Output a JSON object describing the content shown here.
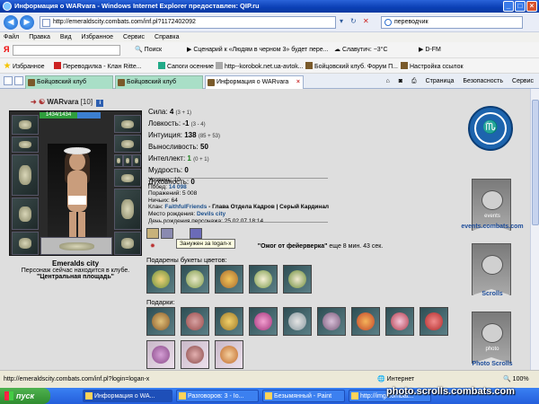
{
  "window": {
    "title": "Информация о WARvara - Windows Internet Explorer предоставлен: QIP.ru"
  },
  "address": {
    "url": "http://emeraldscity.combats.com/inf.pl?1172402092",
    "search_value": "переводчик"
  },
  "menu": [
    "Файл",
    "Правка",
    "Вид",
    "Избранное",
    "Сервис",
    "Справка"
  ],
  "toolbar": {
    "search_btn": "Поиск",
    "script": "Сценарий к «Людям в черном 3» будет пере...",
    "weather": "Славутич: −3°С",
    "dfm": "D-FM"
  },
  "favorites": {
    "label": "Избранное",
    "items": [
      "Переводилка - Клан Ritte...",
      "Сапоги осенние",
      "http--korobok.net.ua-avtok...",
      "Бойцовский клуб. Форум П...",
      "Настройка ссылок"
    ]
  },
  "tabs": [
    {
      "label": "Бойцовский клуб"
    },
    {
      "label": "Бойцовский клуб"
    },
    {
      "label": "Информация о WARvara"
    }
  ],
  "tab_tools": [
    "Страница",
    "Безопасность",
    "Сервис"
  ],
  "character": {
    "name": "WARvara",
    "level": "[10]",
    "hp": "1434/1434",
    "location_city": "Emeralds city",
    "location_text": "Персонаж сейчас находится в клубе.",
    "location_place": "\"Центральная площадь\""
  },
  "stats": [
    {
      "label": "Сила:",
      "value": "4",
      "detail": "(3 + 1)"
    },
    {
      "label": "Ловкость:",
      "value": "-1",
      "detail": "(3 - 4)"
    },
    {
      "label": "Интуиция:",
      "value": "138",
      "detail": "(85 + 53)"
    },
    {
      "label": "Выносливость:",
      "value": "50",
      "detail": ""
    },
    {
      "label": "Интеллект:",
      "value": "1",
      "detail": "(0 + 1)"
    },
    {
      "label": "Мудрость:",
      "value": "0",
      "detail": ""
    },
    {
      "label": "Духовность:",
      "value": "0",
      "detail": ""
    }
  ],
  "info": {
    "level": "Уровень: 10",
    "wins_label": "Побед:",
    "wins": "14 098",
    "losses": "Поражений: 5 008",
    "draws": "Ничьих: 64",
    "clan_label": "Клан:",
    "clan": "FaithfulFriends",
    "clan_rest": " - Глава Отдела Кадров | Серый Кардинал",
    "birthplace_label": "Место рождения:",
    "birthplace": "Devils city",
    "birthday": "День рождения персонажа: 25.02.07 18:14"
  },
  "effects": {
    "tooltip": "Занужен за logan-x",
    "line_prefix": "\"Ожог от фейерверка\"",
    "line_suffix": " еще 8 мин. 43 сек."
  },
  "flowers_title": "Подарены букеты цветов:",
  "gifts_title": "Подарки:",
  "side": {
    "events": "events.combats.com",
    "scrolls": "Scrolls",
    "photo": "Photo Scrolls",
    "events_banner": "events",
    "photo_banner": "photo"
  },
  "status": {
    "url": "http://emeraldscity.combats.com/inf.pl?login=logan-x",
    "zone": "Интернет",
    "zoom": "100%"
  },
  "taskbar": {
    "start": "пуск",
    "items": [
      "Информация о WA...",
      "Разговоров: 3 - Io...",
      "Безымянный - Paint",
      "http://img.combat..."
    ],
    "watermark": "photo.scrolls.combats.com"
  }
}
